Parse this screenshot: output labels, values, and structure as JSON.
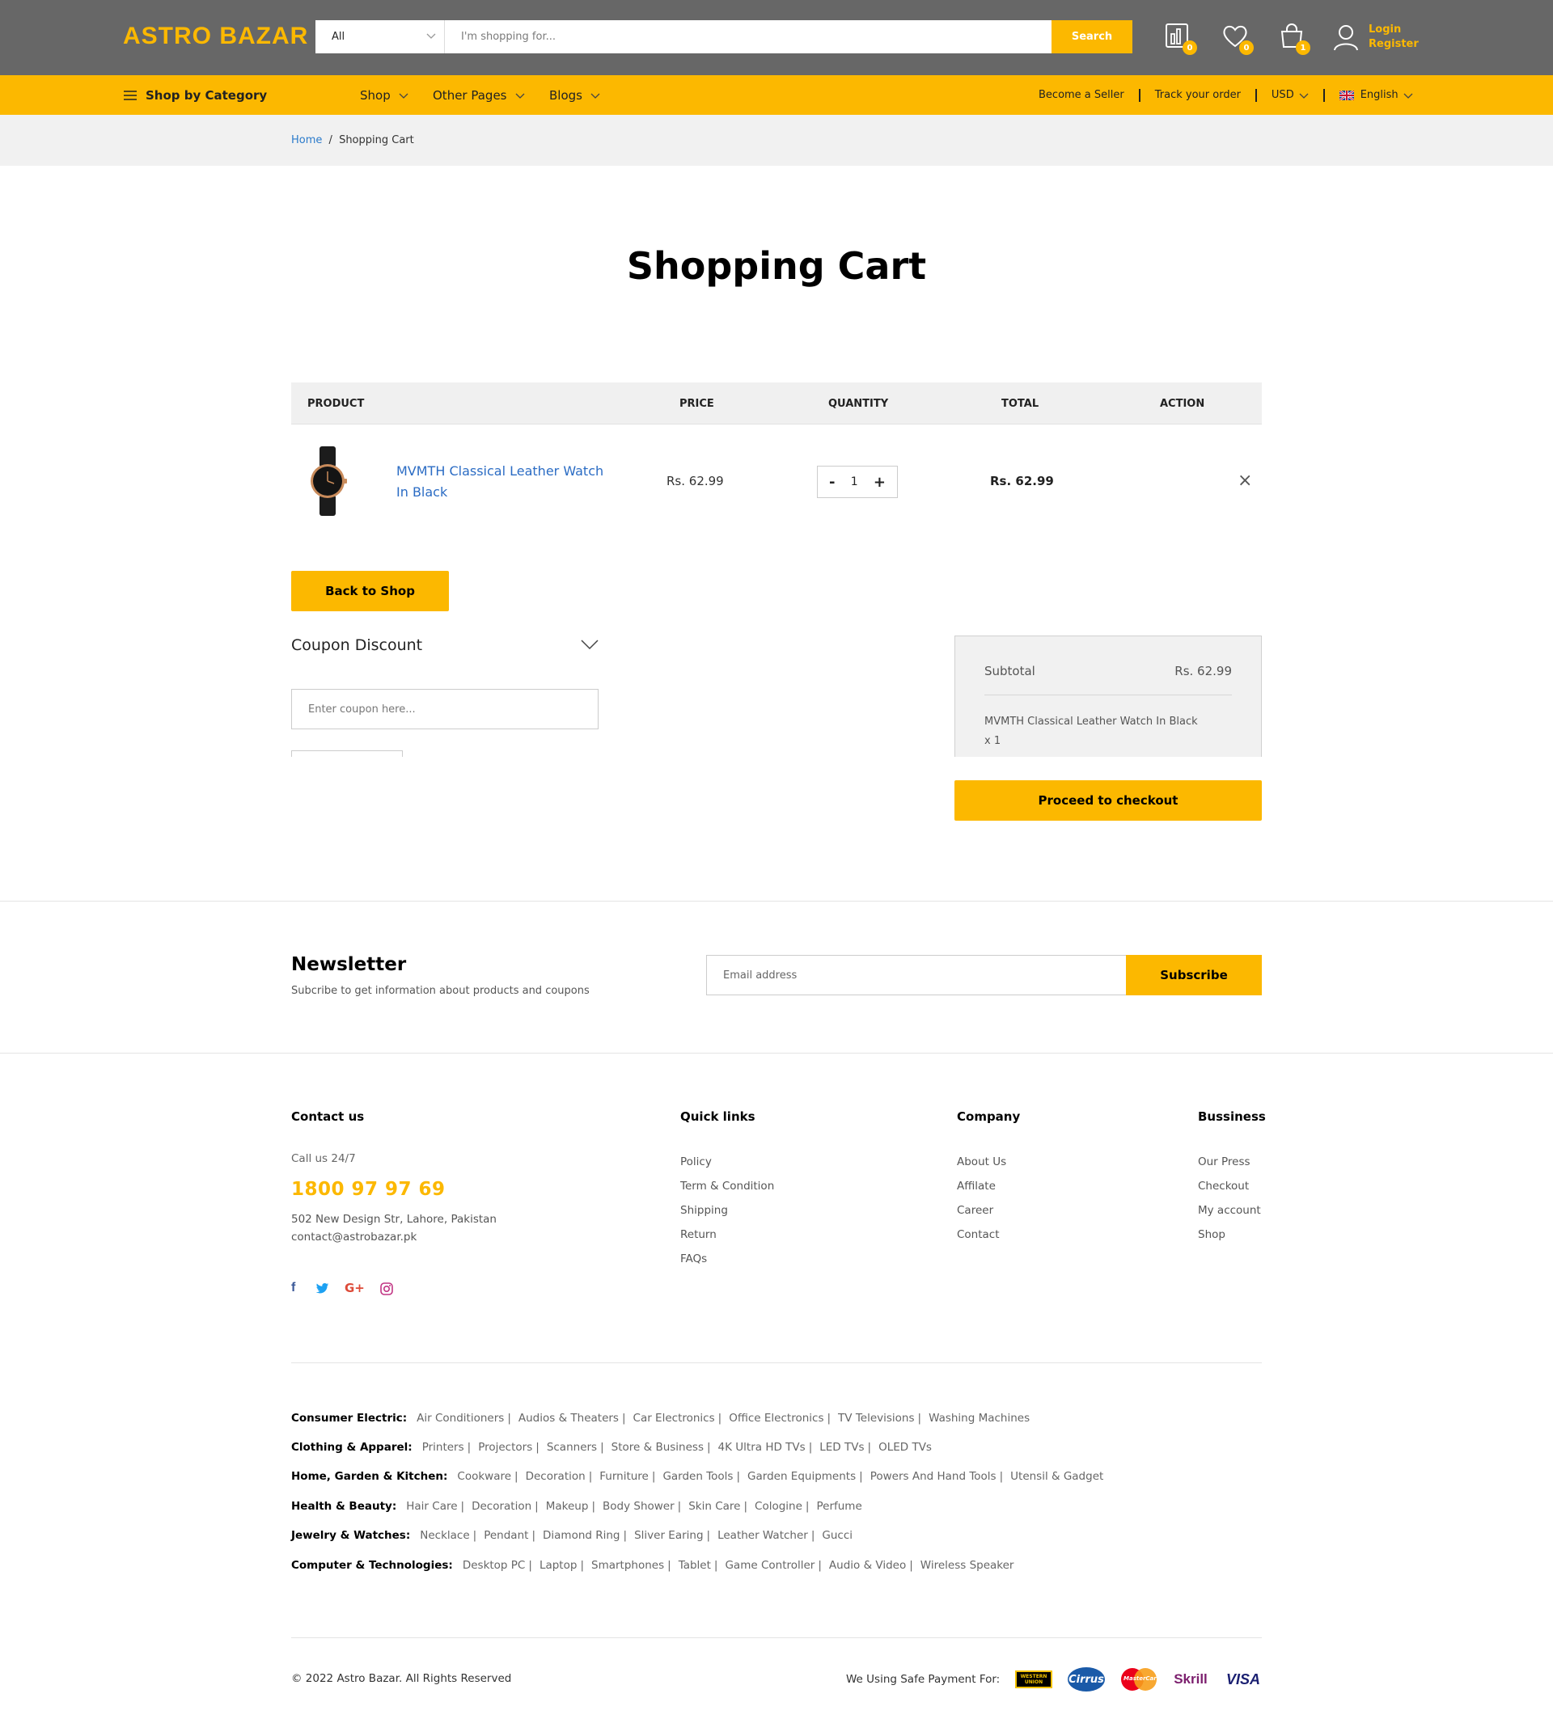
{
  "header": {
    "logo": "ASTRO BAZAR",
    "search": {
      "category": "All",
      "placeholder": "I'm shopping for...",
      "button": "Search"
    },
    "badges": {
      "compare": "0",
      "wishlist": "0",
      "cart": "1"
    },
    "login": "Login",
    "register": "Register"
  },
  "nav": {
    "shop_by_category": "Shop by Category",
    "items": [
      "Shop",
      "Other Pages",
      "Blogs"
    ],
    "become_seller": "Become a Seller",
    "track_order": "Track your order",
    "currency": "USD",
    "language": "English"
  },
  "breadcrumb": {
    "home": "Home",
    "separator": "/",
    "current": "Shopping Cart"
  },
  "page_title": "Shopping Cart",
  "cart": {
    "columns": [
      "PRODUCT",
      "PRICE",
      "QUANTITY",
      "TOTAL",
      "ACTION"
    ],
    "items": [
      {
        "name": "MVMTH Classical Leather Watch In Black",
        "price": "Rs. 62.99",
        "quantity": "1",
        "total": "Rs. 62.99"
      }
    ],
    "qty_minus": "-",
    "qty_plus": "+",
    "remove_symbol": "×",
    "back_to_shop": "Back to Shop"
  },
  "coupon": {
    "title": "Coupon Discount",
    "placeholder": "Enter coupon here..."
  },
  "summary": {
    "subtotal_label": "Subtotal",
    "subtotal_value": "Rs. 62.99",
    "item_line": "MVMTH Classical Leather Watch In Black",
    "item_qty": "x 1",
    "checkout": "Proceed to checkout"
  },
  "newsletter": {
    "title": "Newsletter",
    "subtitle": "Subcribe to get information about products and coupons",
    "placeholder": "Email address",
    "button": "Subscribe"
  },
  "footer": {
    "contact": {
      "title": "Contact us",
      "call_label": "Call us 24/7",
      "phone": "1800 97 97 69",
      "address": "502 New Design Str, Lahore, Pakistan",
      "email": "contact@astrobazar.pk",
      "social": [
        {
          "icon": "facebook-icon",
          "glyph": "f",
          "color": "#3b5998"
        },
        {
          "icon": "twitter-icon",
          "glyph": "🐦",
          "color": "#1da1f2"
        },
        {
          "icon": "google-plus-icon",
          "glyph": "G+",
          "color": "#dd4b39"
        },
        {
          "icon": "instagram-icon",
          "glyph": "◎",
          "color": "#c13584"
        }
      ]
    },
    "quick_links": {
      "title": "Quick links",
      "links": [
        "Policy",
        "Term & Condition",
        "Shipping",
        "Return",
        "FAQs"
      ]
    },
    "company": {
      "title": "Company",
      "links": [
        "About Us",
        "Affilate",
        "Career",
        "Contact"
      ]
    },
    "business": {
      "title": "Bussiness",
      "links": [
        "Our Press",
        "Checkout",
        "My account",
        "Shop"
      ]
    },
    "categories": [
      {
        "heading": "Consumer Electric:",
        "links": [
          "Air Conditioners",
          "Audios & Theaters",
          "Car Electronics",
          "Office Electronics",
          "TV Televisions",
          "Washing Machines"
        ]
      },
      {
        "heading": "Clothing & Apparel:",
        "links": [
          "Printers",
          "Projectors",
          "Scanners",
          "Store & Business",
          "4K Ultra HD TVs",
          "LED TVs",
          "OLED TVs"
        ]
      },
      {
        "heading": "Home, Garden & Kitchen:",
        "links": [
          "Cookware",
          "Decoration",
          "Furniture",
          "Garden Tools",
          "Garden Equipments",
          "Powers And Hand Tools",
          "Utensil & Gadget"
        ]
      },
      {
        "heading": "Health & Beauty:",
        "links": [
          "Hair Care",
          "Decoration",
          "Makeup",
          "Body Shower",
          "Skin Care",
          "Cologine",
          "Perfume"
        ]
      },
      {
        "heading": "Jewelry & Watches:",
        "links": [
          "Necklace",
          "Pendant",
          "Diamond Ring",
          "Sliver Earing",
          "Leather Watcher",
          "Gucci"
        ]
      },
      {
        "heading": "Computer & Technologies:",
        "links": [
          "Desktop PC",
          "Laptop",
          "Smartphones",
          "Tablet",
          "Game Controller",
          "Audio & Video",
          "Wireless Speaker"
        ]
      }
    ],
    "pipe": "|",
    "copyright": "© 2022 Astro Bazar. All Rights Reserved",
    "payment_label": "We Using Safe Payment For:",
    "payments": [
      "WESTERN UNION",
      "Cirrus",
      "MasterCard",
      "Skrill",
      "VISA"
    ]
  },
  "colors": {
    "accent": "#fcb800",
    "header_bg": "#676767",
    "link_blue": "#2b6cc4"
  }
}
